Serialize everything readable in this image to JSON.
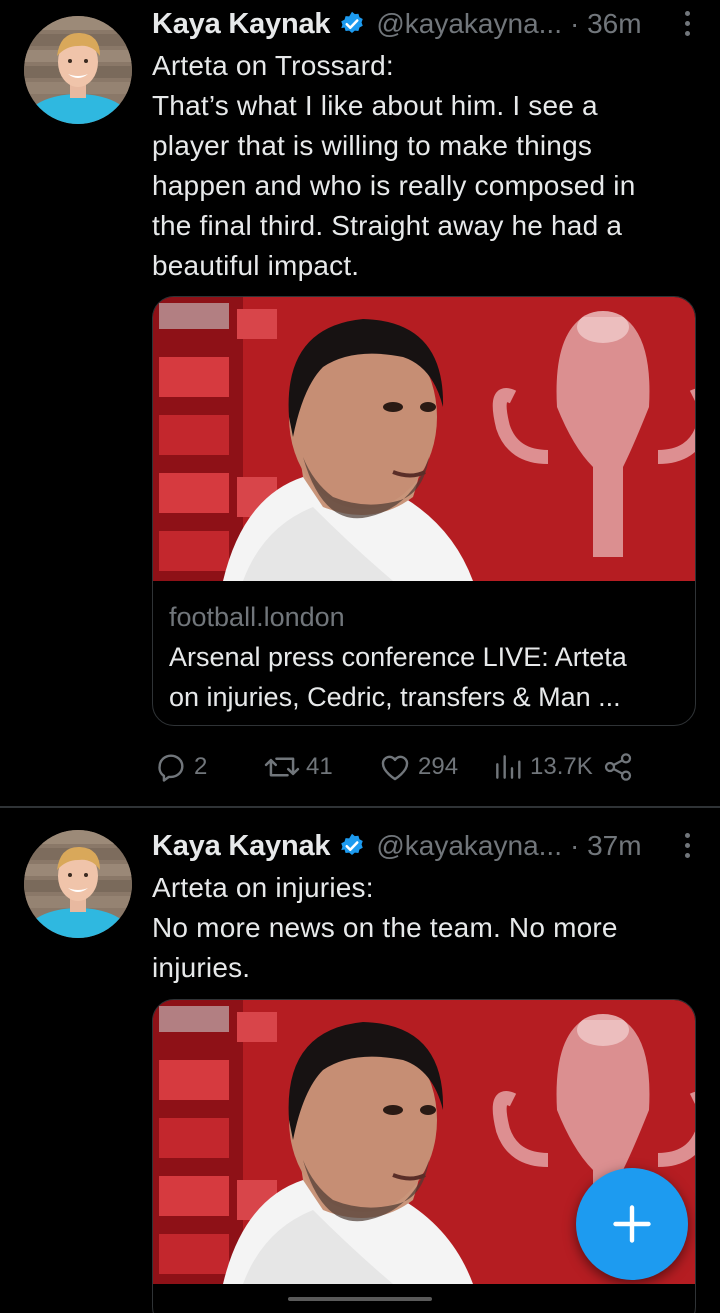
{
  "tweets": [
    {
      "author_name": "Kaya Kaynak",
      "handle": "@kayakayna...",
      "time": "· 36m",
      "lines": [
        "Arteta on Trossard:",
        "That’s what I like about him. I see a",
        "player that is willing to make things",
        "happen and who is really composed in",
        "the final third. Straight away he had a",
        "beautiful impact."
      ],
      "card": {
        "domain": "football.london",
        "title_lines": [
          "Arsenal press conference LIVE: Arteta",
          "on injuries, Cedric, transfers & Man ..."
        ]
      },
      "actions": {
        "replies": "2",
        "retweets": "41",
        "likes": "294",
        "views": "13.7K"
      }
    },
    {
      "author_name": "Kaya Kaynak",
      "handle": "@kayakayna...",
      "time": "· 37m",
      "lines": [
        "Arteta on injuries:",
        "No more news on the team. No more",
        "injuries."
      ]
    }
  ],
  "icons": {
    "verified": "verified-badge-icon",
    "more": "more-vertical-icon",
    "reply": "reply-icon",
    "retweet": "retweet-icon",
    "like": "heart-icon",
    "views": "analytics-icon",
    "share": "share-icon",
    "compose": "plus-icon"
  },
  "colors": {
    "background": "#000000",
    "text": "#e7e9ea",
    "secondary": "#71767b",
    "accent": "#1d9bf0",
    "divider": "#2f3336"
  }
}
